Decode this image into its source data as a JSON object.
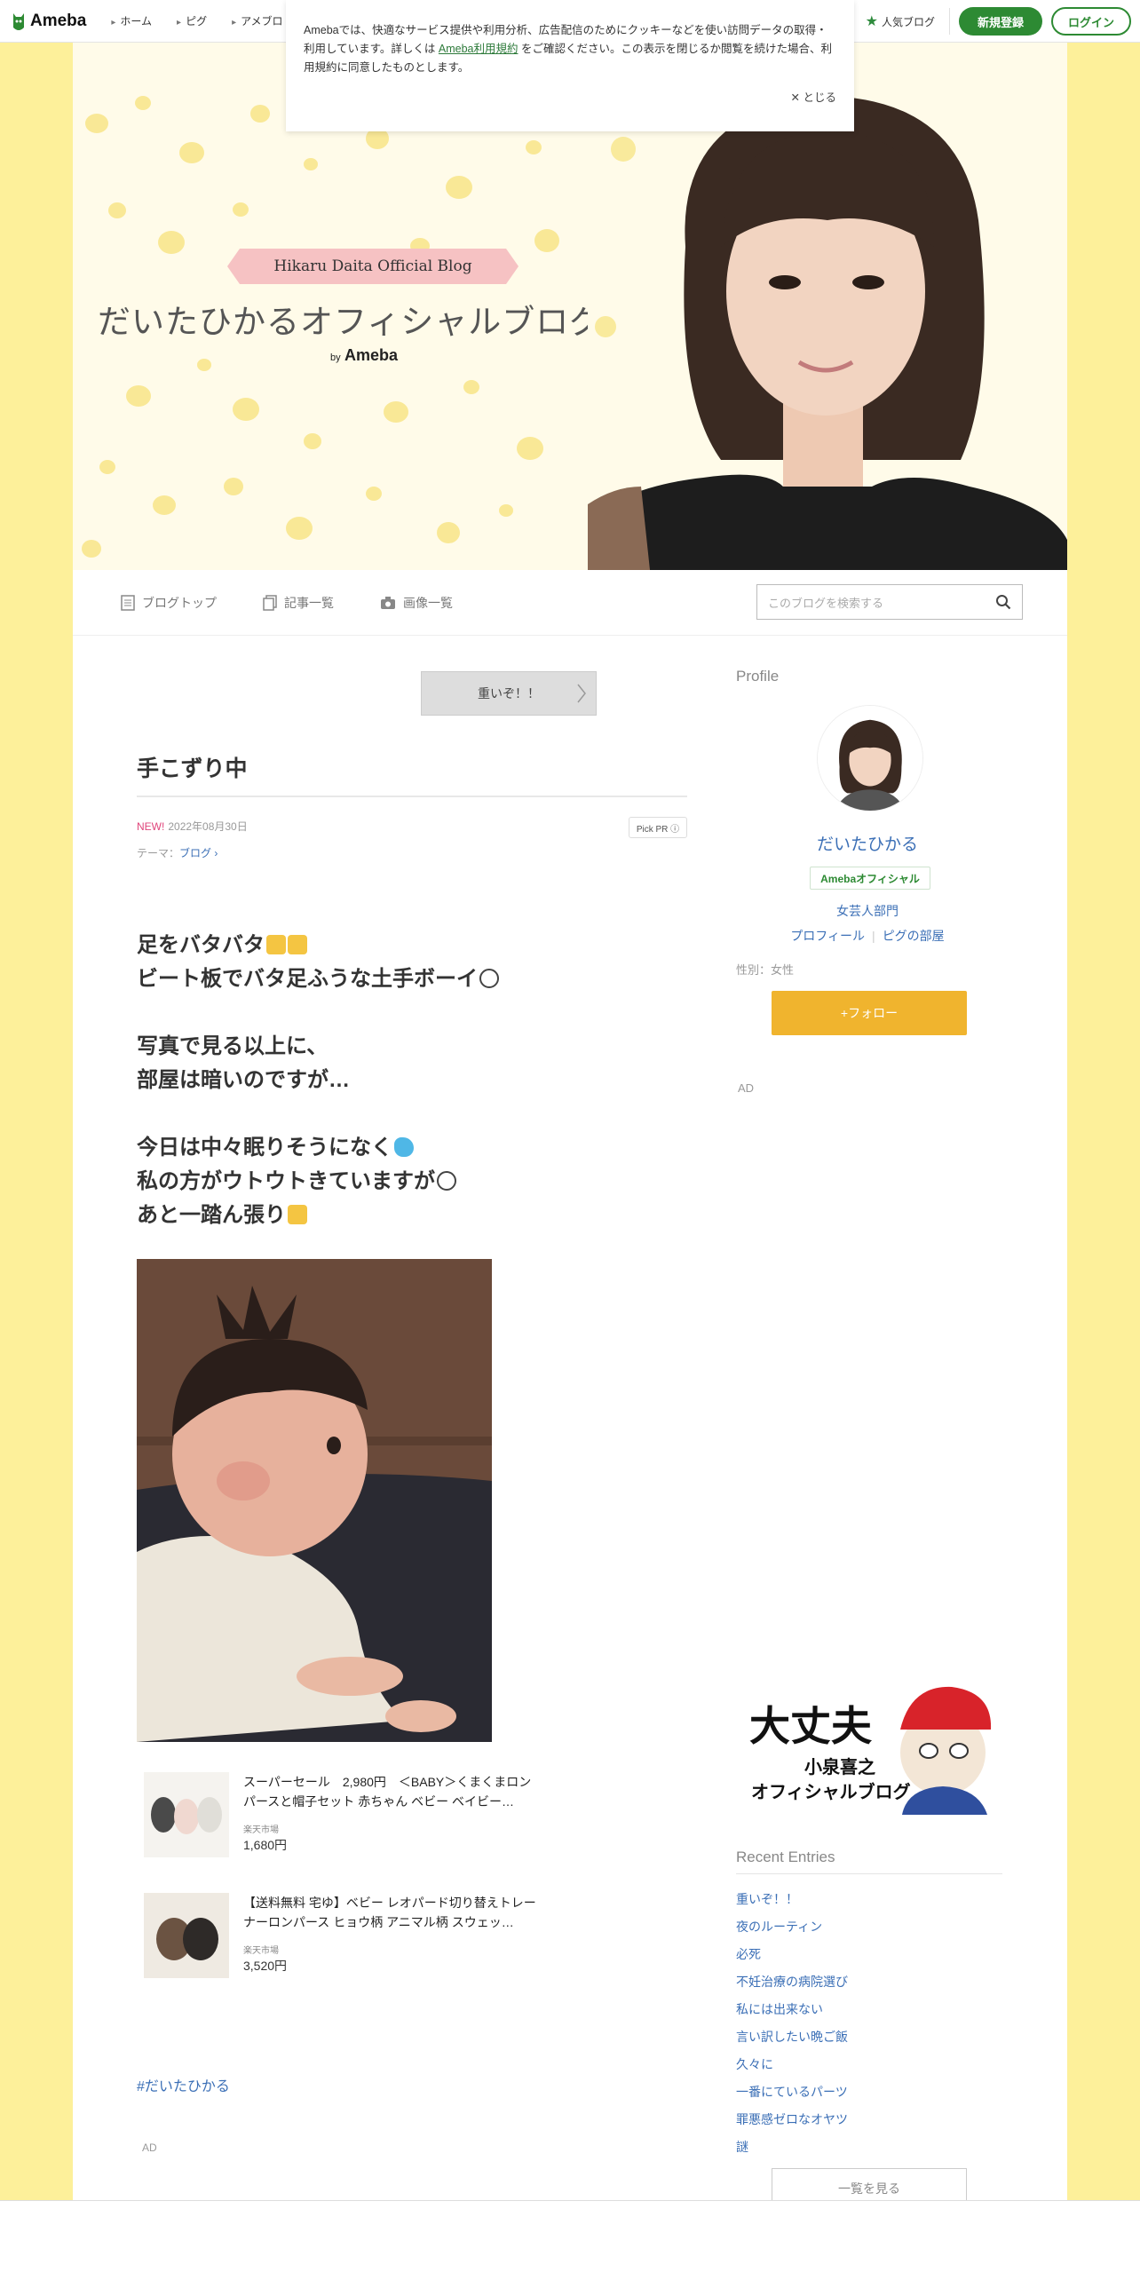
{
  "topbar": {
    "logo_text": "Ameba",
    "nav": [
      "ホーム",
      "ピグ",
      "アメブロ"
    ],
    "popular_label": "人気ブログ",
    "signup_label": "新規登録",
    "login_label": "ログイン"
  },
  "cookie": {
    "text_before": "Amebaでは、快適なサービス提供や利用分析、広告配信のためにクッキーなどを使い訪問データの取得・利用しています。詳しくは",
    "link_text": "Ameba利用規約",
    "text_after": "をご確認ください。この表示を閉じるか閲覧を続けた場合、利用規約に同意したものとします。",
    "close_label": "とじる"
  },
  "header": {
    "ribbon": "Hikaru Daita Official Blog",
    "title": "だいたひかるオフィシャルブログ",
    "by": "by",
    "by_brand": "Ameba"
  },
  "subnav": {
    "items": [
      "ブログトップ",
      "記事一覧",
      "画像一覧"
    ],
    "search_placeholder": "このブログを検索する"
  },
  "article": {
    "prev_label": "重いぞ！！",
    "title": "手こずり中",
    "new_label": "NEW!",
    "date": "2022年08月30日",
    "pickpr": "Pick PR ⓘ",
    "theme_label": "テーマ：",
    "theme_value": "ブログ",
    "lines": [
      "足をバタバタ",
      "ビート板でバタ足ふうな土手ボーイ",
      "写真で見る以上に、",
      "部屋は暗いのですが…",
      "今日は中々眠りそうになく",
      "私の方がウトウトきていますが",
      "あと一踏ん張り"
    ],
    "hashtag": "#だいたひかる",
    "ad_label": "AD"
  },
  "products": [
    {
      "title": "スーパーセール　2,980円　＜BABY＞くまくまロンパースと帽子セット 赤ちゃん ベビー ベイビー…",
      "shop": "楽天市場",
      "price": "1,680円"
    },
    {
      "title": "【送料無料 宅ゆ】ベビー レオパード切り替えトレーナーロンパース ヒョウ柄 アニマル柄 スウェッ…",
      "shop": "楽天市場",
      "price": "3,520円"
    }
  ],
  "sidebar": {
    "profile_heading": "Profile",
    "name": "だいたひかる",
    "official_badge": "Amebaオフィシャル",
    "category": "女芸人部門",
    "link_profile": "プロフィール",
    "link_pig": "ピグの部屋",
    "gender": "性別：女性",
    "follow_label": "+フォロー",
    "ad_label": "AD",
    "banner_line1": "大丈夫",
    "banner_line2": "小泉喜之",
    "banner_line3": "オフィシャルブログ",
    "recent_heading": "Recent Entries",
    "recent": [
      "重いぞ！！",
      "夜のルーティン",
      "必死",
      "不妊治療の病院選び",
      "私には出来ない",
      "言い訳したい晩ご飯",
      "久々に",
      "一番にているパーツ",
      "罪悪感ゼロなオヤツ",
      "謎"
    ],
    "see_all": "一覧を見る"
  },
  "colors": {
    "brand_green": "#2d8a33",
    "page_bg": "#fdf09a",
    "link_blue": "#3b6fb6",
    "follow_orange": "#f0b42e"
  }
}
